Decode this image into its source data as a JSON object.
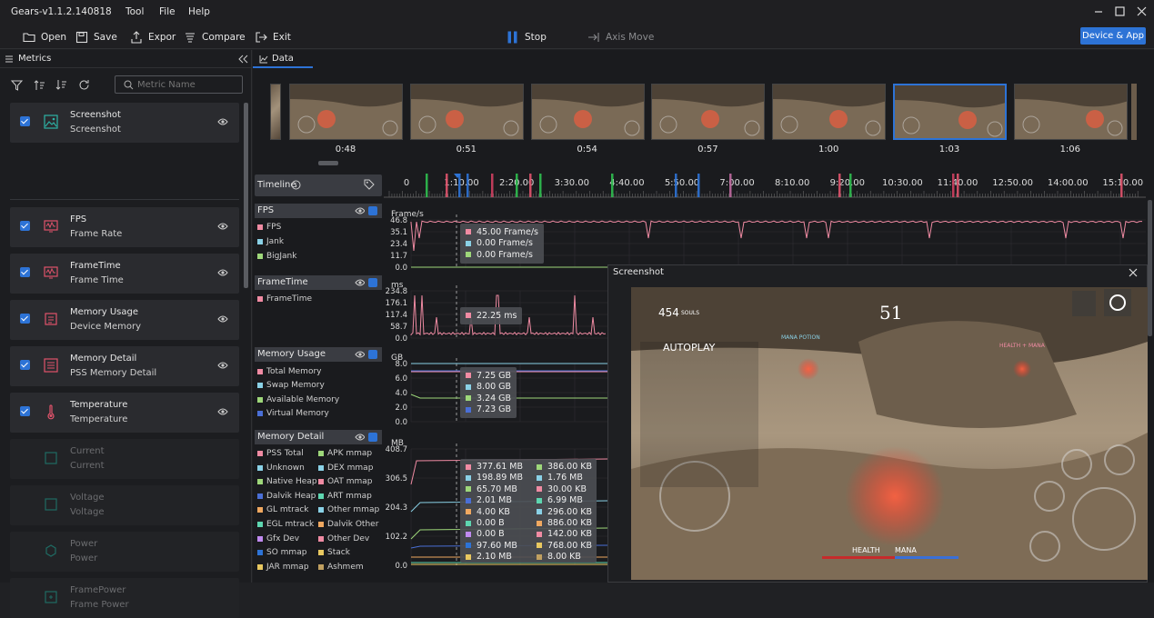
{
  "app": {
    "title": "Gears-v1.1.2.140818"
  },
  "menu": [
    {
      "label": "Tool"
    },
    {
      "label": "File"
    },
    {
      "label": "Help"
    }
  ],
  "toolbar": {
    "open": "Open",
    "save": "Save",
    "export": "Expor",
    "compare": "Compare",
    "exit": "Exit",
    "stop": "Stop",
    "axis_move": "Axis Move",
    "device_app": "Device & App"
  },
  "left": {
    "tab": "Metrics",
    "search_placeholder": "Metric Name",
    "metrics": [
      {
        "title": "Screenshot",
        "subtitle": "Screenshot",
        "checked": true
      },
      {
        "title": "FPS",
        "subtitle": "Frame Rate",
        "checked": true
      },
      {
        "title": "FrameTime",
        "subtitle": "Frame Time",
        "checked": true
      },
      {
        "title": "Memory Usage",
        "subtitle": "Device Memory",
        "checked": true
      },
      {
        "title": "Memory Detail",
        "subtitle": "PSS Memory Detail",
        "checked": true
      },
      {
        "title": "Temperature",
        "subtitle": "Temperature",
        "checked": true
      },
      {
        "title": "Current",
        "subtitle": "Current",
        "checked": false
      },
      {
        "title": "Voltage",
        "subtitle": "Voltage",
        "checked": false
      },
      {
        "title": "Power",
        "subtitle": "Power",
        "checked": false
      },
      {
        "title": "FramePower",
        "subtitle": "Frame Power",
        "checked": false
      }
    ]
  },
  "main": {
    "tab": "Data",
    "thumb_times": [
      "0:48",
      "0:51",
      "0:54",
      "0:57",
      "1:00",
      "1:03",
      "1:06"
    ],
    "timeline_label": "Timeline",
    "timeline_ticks": [
      "0",
      "1:10.00",
      "2:20.00",
      "3:30.00",
      "4:40.00",
      "5:50.00",
      "7:00.00",
      "8:10.00",
      "9:20.00",
      "10:30.00",
      "11:40.00",
      "12:50.00",
      "14:00.00",
      "15:10.00"
    ]
  },
  "rows": {
    "fps": {
      "title": "FPS",
      "unit": "Frame/s",
      "legend": [
        "FPS",
        "Jank",
        "BigJank"
      ],
      "yticks": [
        "46.8",
        "35.1",
        "23.4",
        "11.7",
        "0.0"
      ],
      "tip": [
        "45.00  Frame/s",
        "0.00  Frame/s",
        "0.00  Frame/s"
      ]
    },
    "frametime": {
      "title": "FrameTime",
      "unit": "ms",
      "legend": [
        "FrameTime"
      ],
      "yticks": [
        "234.8",
        "176.1",
        "117.4",
        "58.7",
        "0.0"
      ],
      "tip": [
        "22.25  ms"
      ]
    },
    "memory": {
      "title": "Memory Usage",
      "unit": "GB",
      "legend": [
        "Total Memory",
        "Swap Memory",
        "Available Memory",
        "Virtual Memory"
      ],
      "yticks": [
        "8.0",
        "6.0",
        "4.0",
        "2.0",
        "0.0"
      ],
      "tip": [
        "7.25  GB",
        "8.00  GB",
        "3.24  GB",
        "7.23  GB"
      ]
    },
    "detail": {
      "title": "Memory Detail",
      "unit": "MB",
      "legend_left": [
        "PSS Total",
        "Unknown",
        "Native Heap",
        "Dalvik Heap",
        "GL mtrack",
        "EGL mtrack",
        "Gfx Dev",
        "SO mmap",
        "JAR mmap"
      ],
      "legend_right": [
        "APK mmap",
        "DEX mmap",
        "OAT mmap",
        "ART mmap",
        "Other mmap",
        "Dalvik Other",
        "Other Dev",
        "Stack",
        "Ashmem"
      ],
      "yticks": [
        "408.7",
        "306.5",
        "204.3",
        "102.2",
        "0.0"
      ],
      "tip_left": [
        "377.61  MB",
        "198.89  MB",
        "65.70  MB",
        "2.01  MB",
        "4.00  KB",
        "0.00  B",
        "0.00  B",
        "97.60  MB",
        "2.10  MB"
      ],
      "tip_right": [
        "386.00  KB",
        "1.76  MB",
        "30.00  KB",
        "6.99  MB",
        "296.00  KB",
        "886.00  KB",
        "142.00  KB",
        "768.00  KB",
        "8.00  KB"
      ]
    }
  },
  "screenshot_window": {
    "title": "Screenshot"
  },
  "game": {
    "souls": "454",
    "souls_label": "SOULS",
    "counter": "51",
    "autoplay": "AUTOPLAY",
    "mana_potion": "MANA POTION",
    "health_mana": "HEALTH + MANA",
    "health": "HEALTH",
    "mana": "MANA"
  },
  "colors": {
    "accent": "#2d73d6",
    "pink": "#f08ba3",
    "cyan": "#8ad1e6",
    "green": "#9ed77a",
    "blue": "#4a6fd6",
    "teal": "#5ed6b0",
    "orange": "#f0a860",
    "purple": "#c08af0",
    "yellow": "#e8c860",
    "grey": "#9fa3a9"
  }
}
